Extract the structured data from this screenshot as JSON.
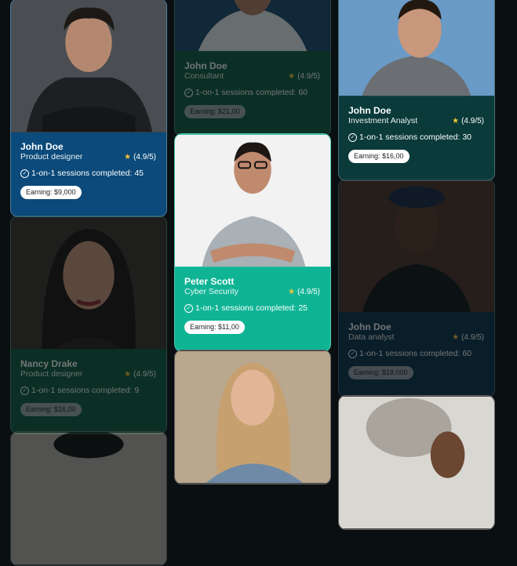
{
  "rating_label_prefix": "(",
  "cards": [
    {
      "name": "John Doe",
      "role": "Product designer",
      "rating": "(4.9/5)",
      "sessions": "1-on-1 sessions completed: 45",
      "earning": "Earning: $9,000",
      "color": "#0b4a7a"
    },
    {
      "name": "Nancy Drake",
      "role": "Product designer",
      "rating": "(4.9/5)",
      "sessions": "1-on-1 sessions completed: 9",
      "earning": "Earning: $16,00",
      "color": "#0e5a3e"
    },
    {
      "name": "John Doe",
      "role": "Consultant",
      "rating": "(4.9/5)",
      "sessions": "1-on-1 sessions completed: 60",
      "earning": "Earning: $21,00",
      "color": "#0e5a3e"
    },
    {
      "name": "Peter Scott",
      "role": "Cyber Security",
      "rating": "(4.9/5)",
      "sessions": "1-on-1 sessions completed: 25",
      "earning": "Earning: $11,00",
      "color": "#0fb495"
    },
    {
      "name": "John Doe",
      "role": "Investment Analyst",
      "rating": "(4.9/5)",
      "sessions": "1-on-1 sessions completed: 30",
      "earning": "Earning: $16,00",
      "color": "#0a3a3a"
    },
    {
      "name": "John Doe",
      "role": "Data analyst",
      "rating": "(4.9/5)",
      "sessions": "1-on-1 sessions completed: 60",
      "earning": "Earning: $18,000",
      "color": "#08324a"
    }
  ]
}
